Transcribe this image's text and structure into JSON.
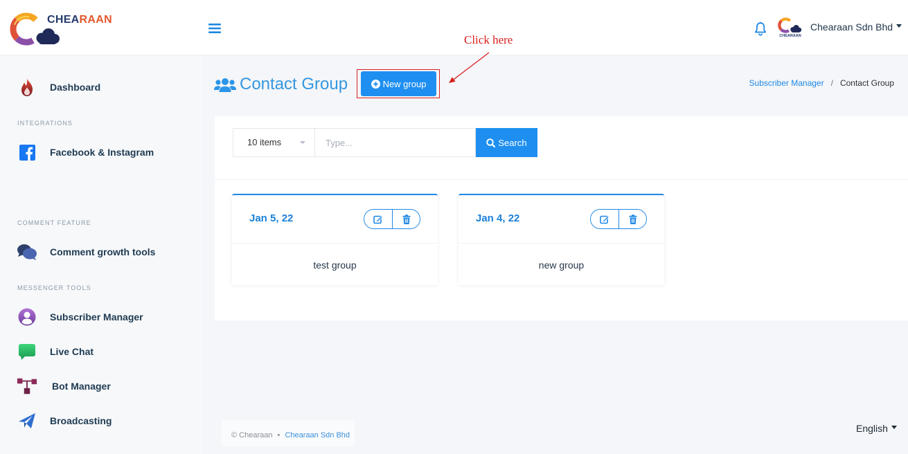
{
  "header": {
    "brand_a": "CHEA",
    "brand_b": "RAAN",
    "avatar_label": "CHEARAAN",
    "account_name": "Chearaan Sdn Bhd",
    "icons": {
      "menu": "hamburger-icon",
      "notifications": "bell-icon",
      "account_caret": "caret-down-icon"
    }
  },
  "sidebar": {
    "items": [
      {
        "label": "Dashboard",
        "icon": "fire-icon"
      },
      {
        "label": "Facebook & Instagram",
        "icon": "facebook-icon"
      },
      {
        "label": "Comment growth tools",
        "icon": "comments-icon"
      },
      {
        "label": "Subscriber Manager",
        "icon": "user-circle-icon"
      },
      {
        "label": "Live Chat",
        "icon": "chat-bubble-icon"
      },
      {
        "label": "Bot Manager",
        "icon": "flowchart-icon"
      },
      {
        "label": "Broadcasting",
        "icon": "paper-plane-icon"
      }
    ],
    "headings": [
      "INTEGRATIONS",
      "COMMENT FEATURE",
      "MESSENGER TOOLS"
    ]
  },
  "page": {
    "title": "Contact Group",
    "title_icon": "users-icon",
    "new_group_button": "New group",
    "new_group_icon": "plus-circle-icon",
    "breadcrumb": {
      "parent": "Subscriber Manager",
      "separator": "/",
      "current": "Contact Group"
    }
  },
  "annotation": {
    "label": "Click here"
  },
  "filter": {
    "page_size": "10 items",
    "search_placeholder": "Type...",
    "search_button": "Search",
    "search_icon": "search-icon"
  },
  "groups": [
    {
      "date": "Jan 5, 22",
      "name": "test group"
    },
    {
      "date": "Jan 4, 22",
      "name": "new group"
    }
  ],
  "footer": {
    "copyright": "© Chearaan",
    "separator": "•",
    "company": "Chearaan Sdn Bhd",
    "language": "English"
  },
  "colors": {
    "primary": "#1e8ff0",
    "link": "#1e88e5",
    "title": "#3597e0",
    "annotation": "#d91e1e",
    "sidebar_text": "#1f3a51"
  }
}
